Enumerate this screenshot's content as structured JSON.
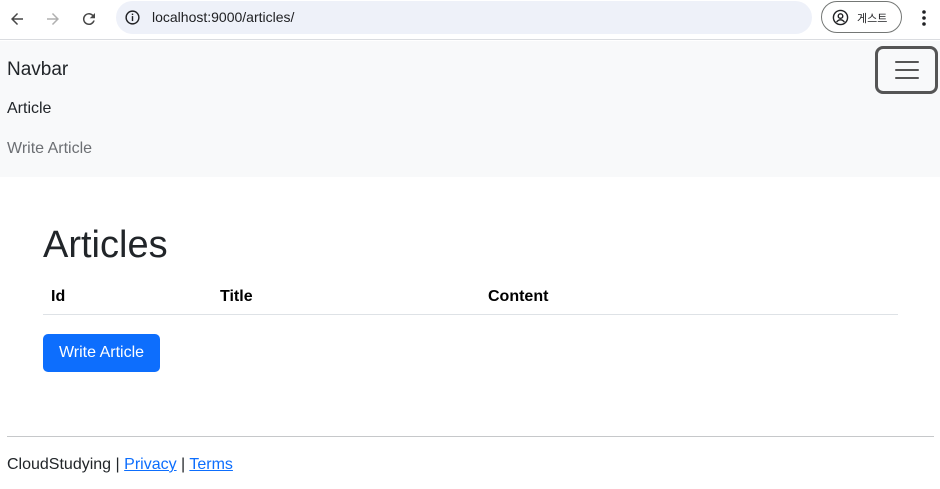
{
  "browser": {
    "url": "localhost:9000/articles/",
    "profile_label": "게스트"
  },
  "navbar": {
    "brand": "Navbar",
    "items": [
      {
        "label": "Article"
      },
      {
        "label": "Write Article"
      }
    ]
  },
  "main": {
    "title": "Articles",
    "table": {
      "headers": [
        "Id",
        "Title",
        "Content"
      ]
    },
    "write_button_label": "Write Article"
  },
  "footer": {
    "brand": "CloudStudying",
    "separator": "|",
    "links": [
      "Privacy",
      "Terms"
    ]
  },
  "colors": {
    "primary": "#0d6efd",
    "navbar_bg": "#f8f9fa"
  }
}
